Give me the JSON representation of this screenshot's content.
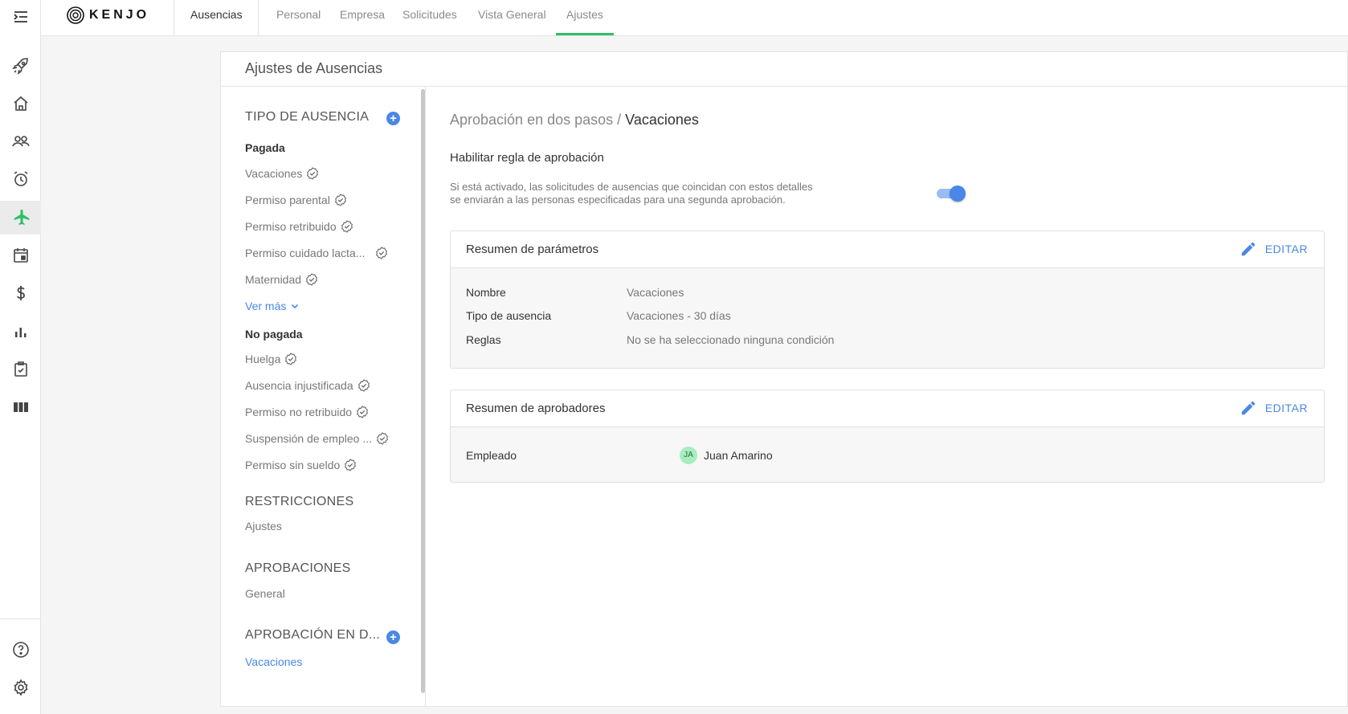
{
  "brand": {
    "name": "KENJO",
    "accent": "#2dbf6a",
    "link": "#4a87e6"
  },
  "topbar": {
    "section": "Ausencias",
    "tabs": [
      "Personal",
      "Empresa",
      "Solicitudes",
      "Vista General",
      "Ajustes"
    ],
    "active_tab": "Ajustes"
  },
  "rail": {
    "items": [
      "menu-icon",
      "rocket-icon",
      "home-icon",
      "people-icon",
      "alarm-icon",
      "airplane-icon",
      "calendar-icon",
      "dollar-icon",
      "bar-chart-icon",
      "checklist-icon",
      "columns-icon",
      "help-icon",
      "gear-icon"
    ],
    "active": "airplane-icon"
  },
  "card": {
    "title": "Ajustes de Ausencias"
  },
  "left_panel": {
    "tipo_header": "TIPO DE AUSENCIA",
    "pagada_label": "Pagada",
    "pagada_items": [
      "Vacaciones",
      "Permiso parental",
      "Permiso retribuido",
      "Permiso cuidado lacta...",
      "Maternidad"
    ],
    "ver_mas": "Ver más",
    "no_pagada_label": "No pagada",
    "no_pagada_items": [
      "Huelga",
      "Ausencia injustificada",
      "Permiso no retribuido",
      "Suspensión de empleo ...",
      "Permiso sin sueldo"
    ],
    "restricciones_header": "RESTRICCIONES",
    "restricciones_item": "Ajustes",
    "aprobaciones_header": "APROBACIONES",
    "aprobaciones_item": "General",
    "dos_pasos_header": "APROBACIÓN EN D...",
    "dos_pasos_item": "Vacaciones"
  },
  "detail": {
    "breadcrumb_parent": "Aprobación en dos pasos /",
    "breadcrumb_current": "Vacaciones",
    "rule_title": "Habilitar regla de aprobación",
    "rule_desc_line1": "Si está activado, las solicitudes de ausencias que coincidan con estos detalles",
    "rule_desc_line2": "se enviarán a las personas especificadas para una segunda aprobación.",
    "toggle_on": true,
    "params": {
      "title": "Resumen de parámetros",
      "edit": "EDITAR",
      "rows": [
        {
          "key": "Nombre",
          "value": "Vacaciones"
        },
        {
          "key": "Tipo de ausencia",
          "value": "Vacaciones - 30 días"
        },
        {
          "key": "Reglas",
          "value": "No se ha seleccionado ninguna condición"
        }
      ]
    },
    "approvers": {
      "title": "Resumen de aprobadores",
      "edit": "EDITAR",
      "role": "Empleado",
      "initials": "JA",
      "name": "Juan Amarino"
    }
  }
}
